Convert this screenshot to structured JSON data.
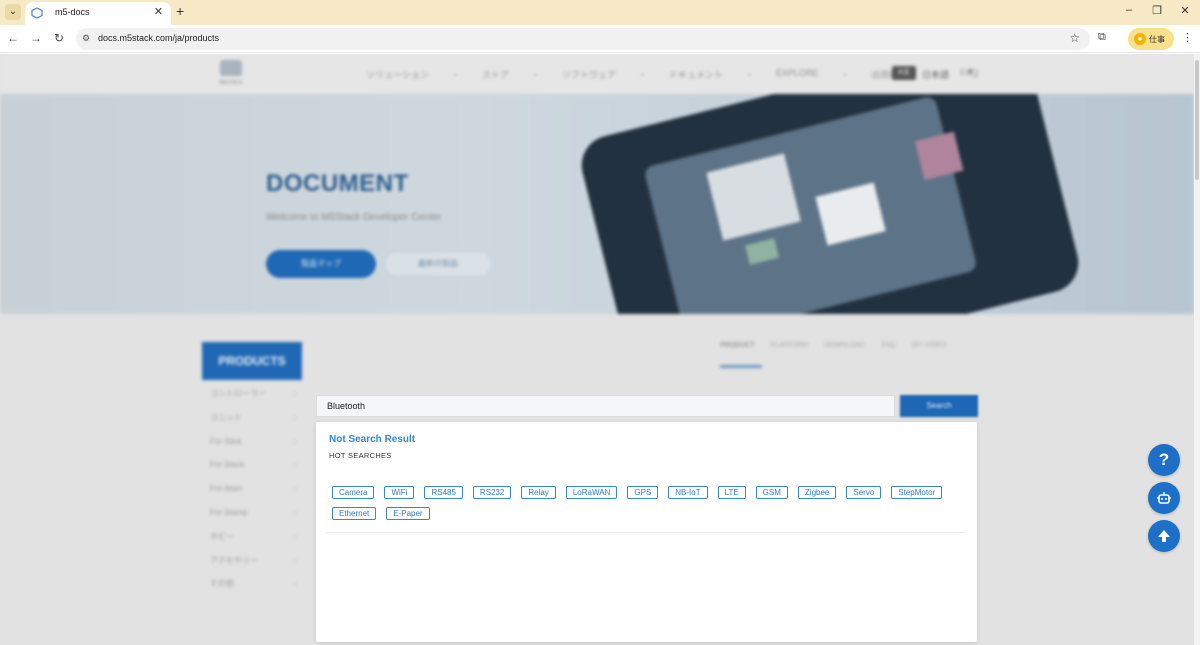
{
  "browser": {
    "tab_title": "m5-docs",
    "tab_close": "✕",
    "new_tab": "+",
    "url": "docs.m5stack.com/ja/products",
    "profile_label": "仕事",
    "window_minimize": "–",
    "window_maximize": "❐",
    "window_close": "✕"
  },
  "site": {
    "logo_text": "M5STACK",
    "nav": [
      "ソリューション",
      "・",
      "ストア",
      "・",
      "ソフトウェア",
      "・",
      "ドキュメント",
      "・",
      "EXPLORE",
      "・",
      "出荷概要",
      "・",
      "FAQ"
    ],
    "lang_chip": "A文",
    "lang_label": "日本語",
    "hero_title": "DOCUMENT",
    "hero_subtitle": "Welcome to M5Stack Developer Center",
    "hero_button_primary": "製品マップ",
    "hero_button_secondary": "最新の製品",
    "sidebar_title": "PRODUCTS",
    "sidebar_items": [
      {
        "label": "コントローラー"
      },
      {
        "label": "ユニット"
      },
      {
        "label": "For Stick"
      },
      {
        "label": "For Stack"
      },
      {
        "label": "For Atom"
      },
      {
        "label": "For Stamp"
      },
      {
        "label": "ホビー"
      },
      {
        "label": "アクセサリー"
      },
      {
        "label": "その他"
      }
    ],
    "content_tabs": [
      "PRODUCT",
      "PLATFORM",
      "DOWNLOAD",
      "FAQ",
      "DIY VIDEO"
    ]
  },
  "search": {
    "value": "Bluetooth",
    "button_label": "Search",
    "no_result": "Not Search Result",
    "hot_label": "HOT SEARCHES",
    "hot_tags": [
      "Camera",
      "WiFi",
      "RS485",
      "RS232",
      "Relay",
      "LoRaWAN",
      "GPS",
      "NB-IoT",
      "LTE",
      "GSM",
      "Zigbee",
      "Servo",
      "StepMotor",
      "Ethernet",
      "E-Paper"
    ]
  },
  "floating": {
    "help_label": "?",
    "help_icon": "question-icon",
    "bot_icon": "robot-icon",
    "top_icon": "arrow-up-icon"
  },
  "colors": {
    "accent": "#1e6fc8",
    "tag_border": "#3a86c8",
    "tab_strip": "#f7e9c6"
  }
}
